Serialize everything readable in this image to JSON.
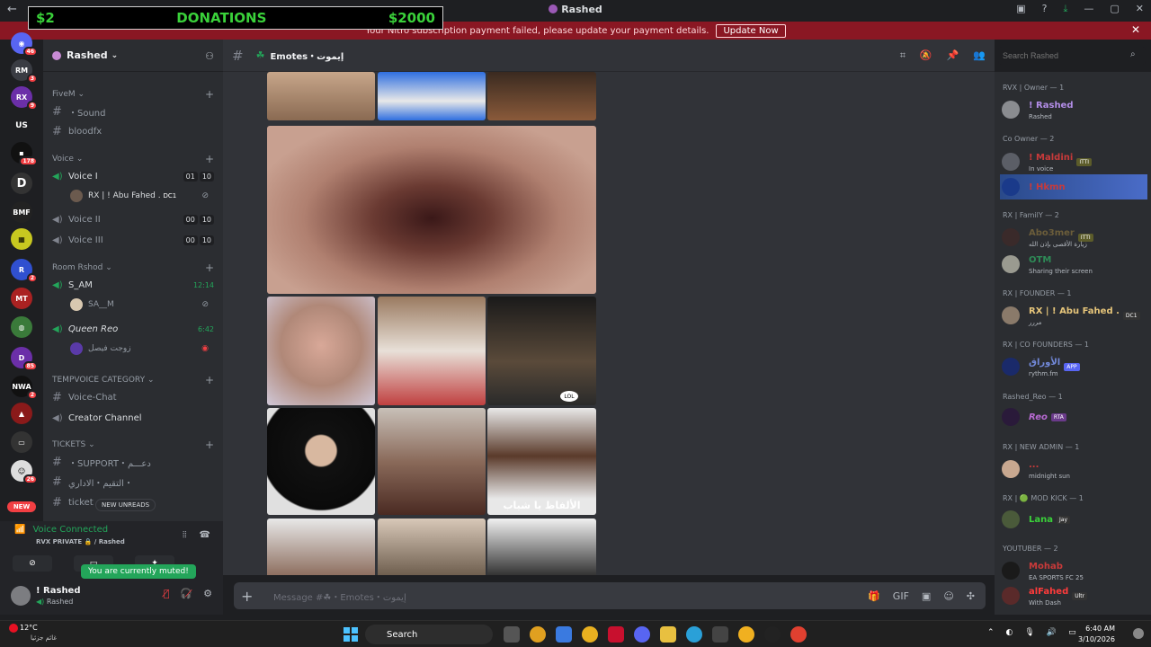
{
  "window": {
    "title": "Rashed",
    "back": "←"
  },
  "overlay": {
    "left": "$2",
    "center": "DONATIONS",
    "right": "$2000"
  },
  "banner": {
    "text": "Your Nitro subscription payment failed, please update your payment details.",
    "button": "Update Now"
  },
  "server_badges": [
    "46",
    "3",
    "9",
    "US",
    "178",
    "D",
    "2",
    "85",
    "2",
    "26",
    "NEW"
  ],
  "guild": {
    "name": "Rashed"
  },
  "channels": {
    "fivem_category": "FiveM",
    "sound": "・Sound",
    "bloodfx": "bloodfx",
    "voice_category": "Voice",
    "voice1": "Voice I",
    "voice1_counts": [
      "01",
      "10"
    ],
    "voice1_user": "RX | ! Abu Fahed .",
    "voice1_user_tag": "DC1",
    "voice2": "Voice II",
    "voice2_counts": [
      "00",
      "10"
    ],
    "voice3": "Voice III",
    "voice3_counts": [
      "00",
      "10"
    ],
    "room_category": "Room Rshod",
    "sam": "S_AM",
    "sam_time": "12:14",
    "sam_user": "SA__M",
    "queen": "Queen Reo",
    "queen_time": "6:42",
    "queen_user": "زوجت فيصل",
    "tempvoice_category": "TEMPVOICE CATEGORY",
    "voice_chat": "Voice-Chat",
    "creator": "Creator Channel",
    "tickets_category": "TICKETS",
    "support": "・SUPPORT・دعـــم",
    "admin": "التقيم・الاداري・",
    "ticket": "ticket",
    "new_unreads": "NEW UNREADS"
  },
  "voice_panel": {
    "status": "Voice Connected",
    "channel": "RVX PRIVATE 🔒 / Rashed",
    "muted_tip": "You are currently muted!"
  },
  "user_panel": {
    "name": "! Rashed",
    "status": "Rashed"
  },
  "header": {
    "channel": "Emotes・إيموت"
  },
  "composer": {
    "placeholder": "Message #☘・Emotes・إيموت"
  },
  "search": {
    "placeholder": "Search Rashed"
  },
  "chat_images": {
    "caption": "الألفاظ يا شباب",
    "lol_tag": "LOL"
  },
  "members": {
    "groups": [
      "RVX | Owner — 1",
      "Co Owner — 2",
      "RX | FamilY — 2",
      "RX | FOUNDER — 1",
      "RX | CO FOUNDERS — 1",
      "Rashed_Reo — 1",
      "RX | NEW ADMIN — 1",
      "RX | 🟢 MOD KICK — 1",
      "YOUTUBER — 2"
    ],
    "list": [
      {
        "name": "! Rashed",
        "status": "Rashed",
        "color": "#b38de8"
      },
      {
        "name": "! Maldini",
        "status": "In voice",
        "color": "#c83a3a",
        "tag": "ITTI"
      },
      {
        "name": "! Hkmn",
        "status": "",
        "color": "#c83a3a"
      },
      {
        "name": "Abo3mer",
        "status": "زيارة الأقصى بإذن الله",
        "color": "#6b5d3a",
        "tag": "ITTI"
      },
      {
        "name": "OTM",
        "status": "Sharing their screen",
        "color": "#2e8b57"
      },
      {
        "name": "RX | ! Abu Fahed .",
        "status": "مررر",
        "color": "#e6c57a",
        "tag": "DC1"
      },
      {
        "name": "الأوراق",
        "status": "rythm.fm",
        "color": "#7289da",
        "tag": "APP"
      },
      {
        "name": "Reo",
        "status": "",
        "color": "#b86ad2",
        "tag": "RTA"
      },
      {
        "name": "...",
        "status": "midnight sun",
        "color": "#c83a3a"
      },
      {
        "name": "Lana",
        "status": "",
        "color": "#3ad13a",
        "tag": "Jay"
      },
      {
        "name": "Mohab",
        "status": "EA SPORTS FC 25",
        "color": "#c83a3a"
      },
      {
        "name": "alFahed",
        "status": "With Dash",
        "color": "#ff3b3b",
        "tag": "Ultr"
      }
    ]
  },
  "taskbar": {
    "temp": "12°C",
    "weather": "غائم جزئيا",
    "search": "Search",
    "time": "6:40 AM",
    "date": "3/10/2026"
  }
}
